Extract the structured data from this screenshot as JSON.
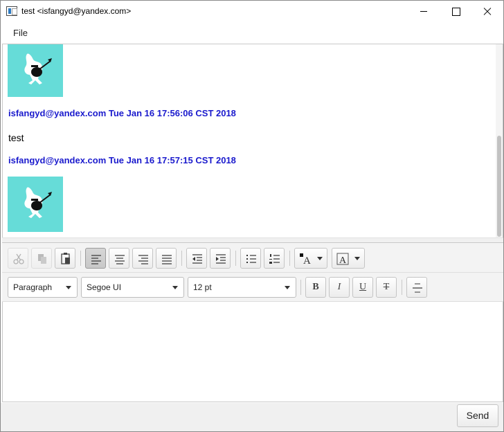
{
  "window": {
    "title": "test <isfangyd@yandex.com>",
    "controls": [
      "minimize",
      "maximize",
      "close"
    ]
  },
  "menu": {
    "items": [
      {
        "label": "File"
      }
    ]
  },
  "messages": [
    {
      "type": "image",
      "description": "sticker"
    },
    {
      "type": "header",
      "sender": "isfangyd@yandex.com",
      "timestamp": "Tue Jan 16 17:56:06 CST 2018"
    },
    {
      "type": "text",
      "body": "test"
    },
    {
      "type": "header",
      "sender": "isfangyd@yandex.com",
      "timestamp": "Tue Jan 16 17:57:15 CST 2018"
    },
    {
      "type": "image",
      "description": "sticker"
    }
  ],
  "headers": [
    "isfangyd@yandex.com Tue Jan 16 17:56:06 CST 2018",
    "isfangyd@yandex.com Tue Jan 16 17:57:15 CST 2018"
  ],
  "toolbar": {
    "paragraph_style": "Paragraph",
    "font_family": "Segoe UI",
    "font_size": "12 pt",
    "bold_label": "B",
    "italic_label": "I",
    "underline_label": "U",
    "strike_label": "T"
  },
  "send_label": "Send",
  "colors": {
    "sender_header": "#1a1acd",
    "sticker_background": "#66dcd8"
  }
}
